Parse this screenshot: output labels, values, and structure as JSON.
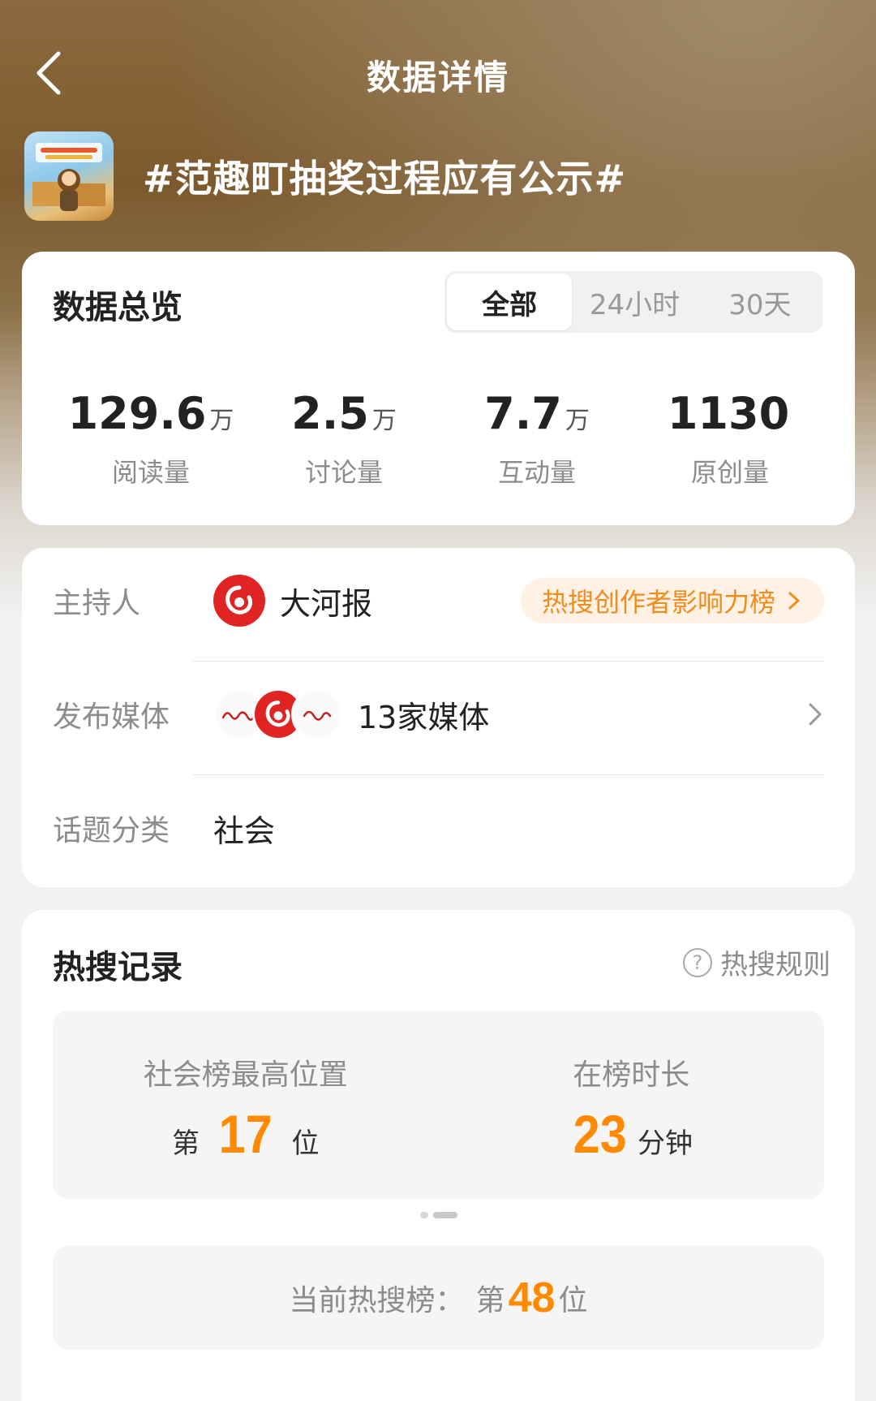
{
  "header": {
    "title": "数据详情"
  },
  "topic": {
    "title": "#范趣町抽奖过程应有公示#"
  },
  "overview": {
    "title": "数据总览",
    "tabs": [
      {
        "label": "全部",
        "active": true
      },
      {
        "label": "24小时",
        "active": false
      },
      {
        "label": "30天",
        "active": false
      }
    ],
    "stats": [
      {
        "value": "129.6",
        "unit": "万",
        "label": "阅读量"
      },
      {
        "value": "2.5",
        "unit": "万",
        "label": "讨论量"
      },
      {
        "value": "7.7",
        "unit": "万",
        "label": "互动量"
      },
      {
        "value": "1130",
        "unit": "",
        "label": "原创量"
      }
    ]
  },
  "info": {
    "host_label": "主持人",
    "host_name": "大河报",
    "rank_link": "热搜创作者影响力榜",
    "media_label": "发布媒体",
    "media_count": "13家媒体",
    "category_label": "话题分类",
    "category_value": "社会"
  },
  "hot": {
    "title": "热搜记录",
    "rule_link": "热搜规则",
    "best_label": "社会榜最高位置",
    "best_prefix": "第",
    "best_value": "17",
    "best_suffix": "位",
    "duration_label": "在榜时长",
    "duration_value": "23",
    "duration_unit": "分钟",
    "current_label": "当前热搜榜：",
    "current_prefix": "第",
    "current_value": "48",
    "current_suffix": "位"
  },
  "colors": {
    "accent": "#ff8a00",
    "brand_red": "#e02424",
    "pill_bg": "#fff1e3"
  }
}
